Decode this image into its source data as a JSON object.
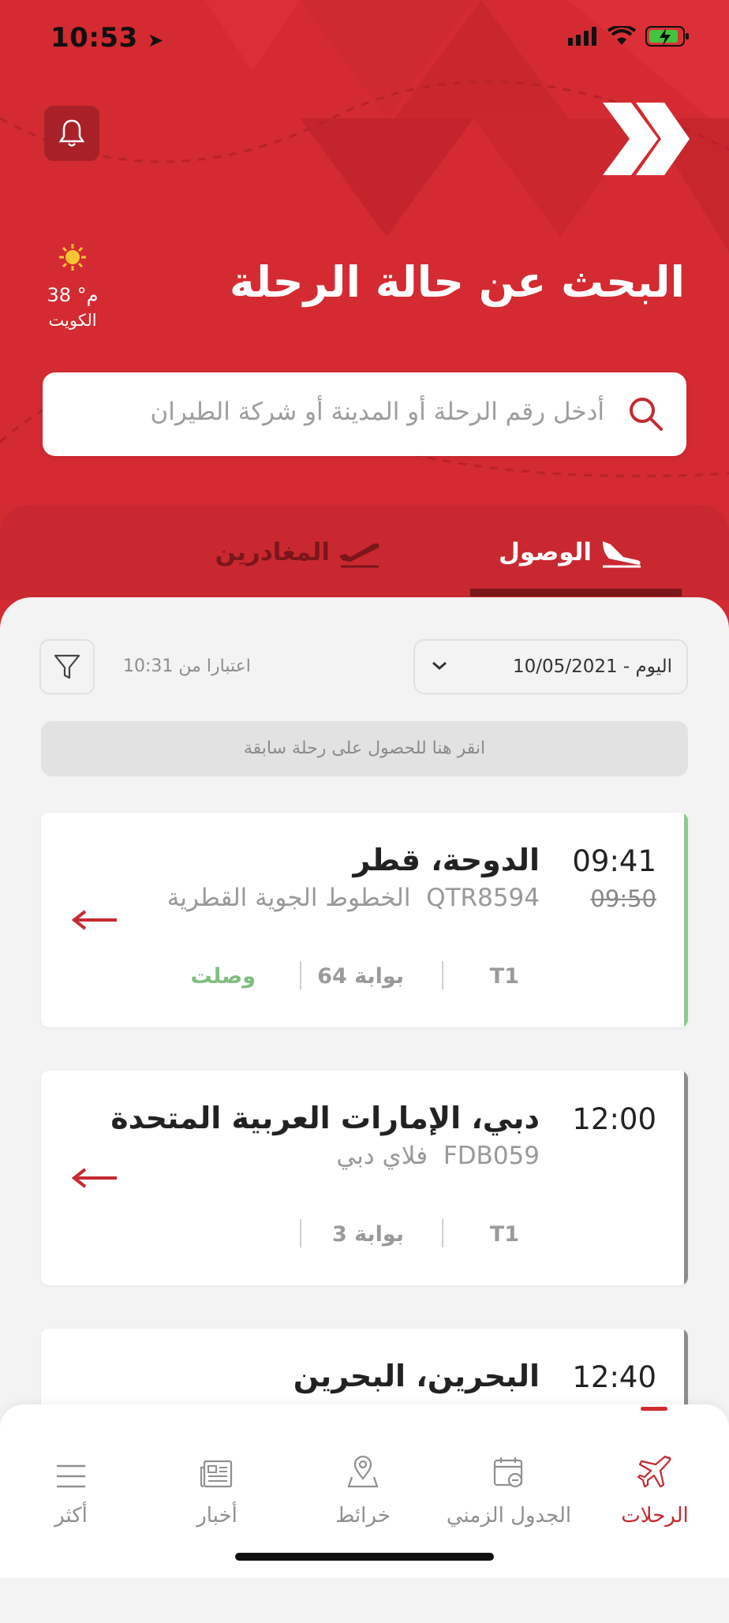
{
  "status_bar": {
    "time": "10:53"
  },
  "header": {
    "title": "البحث عن حالة الرحلة",
    "weather": {
      "temp": "38 °م",
      "city": "الكويت"
    }
  },
  "search": {
    "placeholder": "أدخل رقم الرحلة أو المدينة أو شركة الطيران"
  },
  "tabs": [
    {
      "label": "الوصول",
      "active": true
    },
    {
      "label": "المغادرين",
      "active": false
    }
  ],
  "filters": {
    "date_value": "اليوم - 10/05/2021",
    "as_of": "اعتبارا من 10:31",
    "previous_flight": "انقر هنا للحصول على رحلة سابقة"
  },
  "flights": [
    {
      "time": "09:41",
      "scheduled": "09:50",
      "city": "الدوحة، قطر",
      "flight_no": "QTR8594",
      "airline": "الخطوط الجوية القطرية",
      "terminal": "T1",
      "gate": "بوابة 64",
      "status": "وصلت",
      "edge_color": "#8ccb8c"
    },
    {
      "time": "12:00",
      "scheduled": "",
      "city": "دبي، الإمارات العربية المتحدة",
      "flight_no": "FDB059",
      "airline": "فلاي دبي",
      "terminal": "T1",
      "gate": "بوابة 3",
      "status": "",
      "edge_color": "#8e8e8e"
    },
    {
      "time": "12:40",
      "scheduled": "",
      "city": "البحرين، البحرين",
      "flight_no": "",
      "airline": "",
      "terminal": "",
      "gate": "",
      "status": "",
      "edge_color": "#8e8e8e"
    }
  ],
  "bottom_nav": [
    {
      "label": "الرحلات",
      "icon": "plane-icon",
      "active": true
    },
    {
      "label": "الجدول الزمني",
      "icon": "calendar-icon",
      "active": false
    },
    {
      "label": "خرائط",
      "icon": "map-pin-icon",
      "active": false
    },
    {
      "label": "أخبار",
      "icon": "news-icon",
      "active": false
    },
    {
      "label": "أكثر",
      "icon": "menu-icon",
      "active": false
    }
  ],
  "colors": {
    "brand_red": "#d42a31",
    "arrived_green": "#7fbf7f"
  }
}
